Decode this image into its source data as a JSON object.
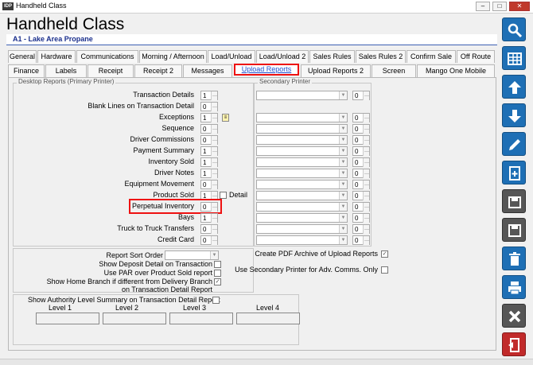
{
  "window": {
    "title": "Handheld Class",
    "app_icon_text": "IDP",
    "min_glyph": "–",
    "max_glyph": "□",
    "close_glyph": "✕"
  },
  "header": {
    "title": "Handheld Class",
    "company": "A1 - Lake Area Propane"
  },
  "tabs_row1": [
    "General",
    "Hardware",
    "Communications",
    "Morning / Afternoon",
    "Load/Unload",
    "Load/Unload 2",
    "Sales Rules",
    "Sales Rules 2",
    "Confirm Sale",
    "Off Route"
  ],
  "tabs_row2": [
    "Finance",
    "Labels",
    "Receipt",
    "Receipt 2",
    "Messages",
    "Upload Reports",
    "Upload Reports 2",
    "Screen",
    "Mango One Mobile"
  ],
  "active_tab": "Upload Reports",
  "desktop_reports": {
    "label": "Desktop Reports (Primary Printer)",
    "rows": [
      {
        "label": "Transaction Details",
        "value": "1"
      },
      {
        "label": "Blank Lines on Transaction Detail",
        "value": "0"
      },
      {
        "label": "Exceptions",
        "value": "1"
      },
      {
        "label": "Sequence",
        "value": "0"
      },
      {
        "label": "Driver Commissions",
        "value": "0"
      },
      {
        "label": "Payment Summary",
        "value": "1"
      },
      {
        "label": "Inventory Sold",
        "value": "1"
      },
      {
        "label": "Driver Notes",
        "value": "1"
      },
      {
        "label": "Equipment Movement",
        "value": "0"
      },
      {
        "label": "Product Sold",
        "value": "1"
      },
      {
        "label": "Perpetual Inventory",
        "value": "0"
      },
      {
        "label": "Bays",
        "value": "1"
      },
      {
        "label": "Truck to Truck Transfers",
        "value": "0"
      },
      {
        "label": "Credit Card",
        "value": "0"
      }
    ],
    "detail_label": "Detail"
  },
  "secondary_printer": {
    "label": "Secondary Printer",
    "values": [
      "0",
      "",
      "0",
      "0",
      "0",
      "0",
      "0",
      "0",
      "0",
      "0",
      "0",
      "0",
      "0",
      "0"
    ]
  },
  "options": {
    "report_sort_order": "Report Sort Order",
    "show_deposit_detail": "Show Deposit Detail on Transaction",
    "use_par": "Use PAR over Product Sold report",
    "show_home_branch_1": "Show Home Branch if different from Delivery Branch",
    "show_home_branch_2": "on Transaction Detail Report",
    "create_pdf": "Create PDF Archive of Upload Reports",
    "use_secondary": "Use Secondary Printer for Adv. Comms. Only",
    "check_mark": "✓"
  },
  "authority": {
    "label": "Show Authority Level Summary on Transaction Detail Report",
    "levels": [
      "Level 1",
      "Level 2",
      "Level 3",
      "Level 4"
    ]
  },
  "colors": {
    "accent_blue": "#1e6fb5",
    "highlight_red": "#e11111",
    "exit_red": "#c12a2a"
  },
  "sidebar_icons": [
    "search-icon",
    "grid-icon",
    "arrow-up-icon",
    "arrow-down-icon",
    "pencil-icon",
    "new-document-icon",
    "copy-icon",
    "save-icon",
    "trash-icon",
    "print-icon",
    "close-icon",
    "exit-icon"
  ]
}
